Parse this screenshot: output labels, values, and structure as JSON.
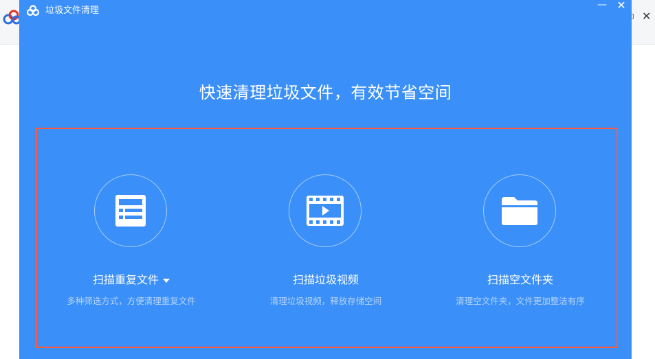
{
  "dialog": {
    "title": "垃圾文件清理",
    "minimize_label": "—",
    "close_label": "✕",
    "headline": "快速清理垃圾文件，有效节省空间"
  },
  "background_app": {
    "restore_label": "▫",
    "close_label": "✕"
  },
  "options": [
    {
      "title": "扫描重复文件",
      "description": "多种筛选方式，方便清理重复文件",
      "icon": "duplicate-list-icon",
      "has_dropdown": true
    },
    {
      "title": "扫描垃圾视频",
      "description": "清理垃圾视频，释放存储空间",
      "icon": "video-film-icon",
      "has_dropdown": false
    },
    {
      "title": "扫描空文件夹",
      "description": "清理空文件夹，文件更加整洁有序",
      "icon": "folder-icon",
      "has_dropdown": false
    }
  ],
  "colors": {
    "dialog_bg": "#3a8ff8",
    "highlight_border": "#ff5a3c",
    "text": "#ffffff"
  }
}
